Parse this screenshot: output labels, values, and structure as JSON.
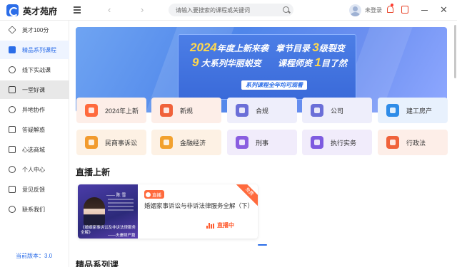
{
  "app": {
    "title": "英才苑府"
  },
  "topbar": {
    "search_placeholder": "请输入要搜索的课程或关键词",
    "login_text": "未登录",
    "back_glyph": "‹",
    "forward_glyph": "›",
    "close_glyph": "✕"
  },
  "sidebar": {
    "items": [
      {
        "label": "英才100分",
        "icon": "diamond-icon"
      },
      {
        "label": "精品系列课程",
        "icon": "book-icon"
      },
      {
        "label": "线下实战课",
        "icon": "target-icon"
      },
      {
        "label": "一堂好课",
        "icon": "video-icon"
      },
      {
        "label": "异地协作",
        "icon": "chat-icon"
      },
      {
        "label": "答疑解惑",
        "icon": "message-icon"
      },
      {
        "label": "心选商城",
        "icon": "shop-icon"
      },
      {
        "label": "个人中心",
        "icon": "user-icon"
      },
      {
        "label": "意见反馈",
        "icon": "feedback-icon"
      },
      {
        "label": "联系我们",
        "icon": "headset-icon"
      }
    ],
    "active_index": 1,
    "hover_index": 3,
    "version_text": "当前版本：3.0"
  },
  "banner": {
    "line1_pre": "2024",
    "line1_post": "年度上新来袭",
    "line2_pre": "9",
    "line2_post": " 大系列华丽蜕变",
    "line3_pre": "章节目录 ",
    "line3_hl": "3",
    "line3_post": "级裂变",
    "line4_pre": "课程师资 ",
    "line4_hl": "1",
    "line4_post": "目了然",
    "tag": "系列课程全年均可观看"
  },
  "categories": [
    {
      "label": "2024年上新",
      "icon": "new-icon",
      "bg": "#fdeee8",
      "icon_color": "#ff6a3d"
    },
    {
      "label": "新规",
      "icon": "document-icon",
      "bg": "#fdeee8",
      "icon_color": "#f0623a"
    },
    {
      "label": "合规",
      "icon": "scale-icon",
      "bg": "#eeeefb",
      "icon_color": "#6b6fd8"
    },
    {
      "label": "公司",
      "icon": "company-icon",
      "bg": "#eeeefb",
      "icon_color": "#6b6fd8"
    },
    {
      "label": "建工房产",
      "icon": "building-icon",
      "bg": "#e8f1fd",
      "icon_color": "#2e8ce8"
    },
    {
      "label": "民商事诉讼",
      "icon": "gavel-icon",
      "bg": "#fdf1e4",
      "icon_color": "#f29b2e"
    },
    {
      "label": "金融经济",
      "icon": "finance-icon",
      "bg": "#fdf1e4",
      "icon_color": "#f2a12e"
    },
    {
      "label": "刑事",
      "icon": "handcuffs-icon",
      "bg": "#f1ecfb",
      "icon_color": "#8a5ee0"
    },
    {
      "label": "执行实务",
      "icon": "badge-icon",
      "bg": "#f1ecfb",
      "icon_color": "#7e5be0"
    },
    {
      "label": "行政法",
      "icon": "courthouse-icon",
      "bg": "#fdeee8",
      "icon_color": "#f0623a"
    }
  ],
  "live": {
    "section_title": "直播上新",
    "badge": "直播",
    "title": "婚姻家事诉讼与非诉法律服务全解（下）",
    "status": "直播中",
    "corner": "免费",
    "thumb_name": "—— 陈 雪",
    "thumb_caption": "《婚姻家事诉讼及非诉法律服务全解》",
    "thumb_caption2": "——夫妻财产篇"
  },
  "series": {
    "section_title": "精品系列课"
  }
}
